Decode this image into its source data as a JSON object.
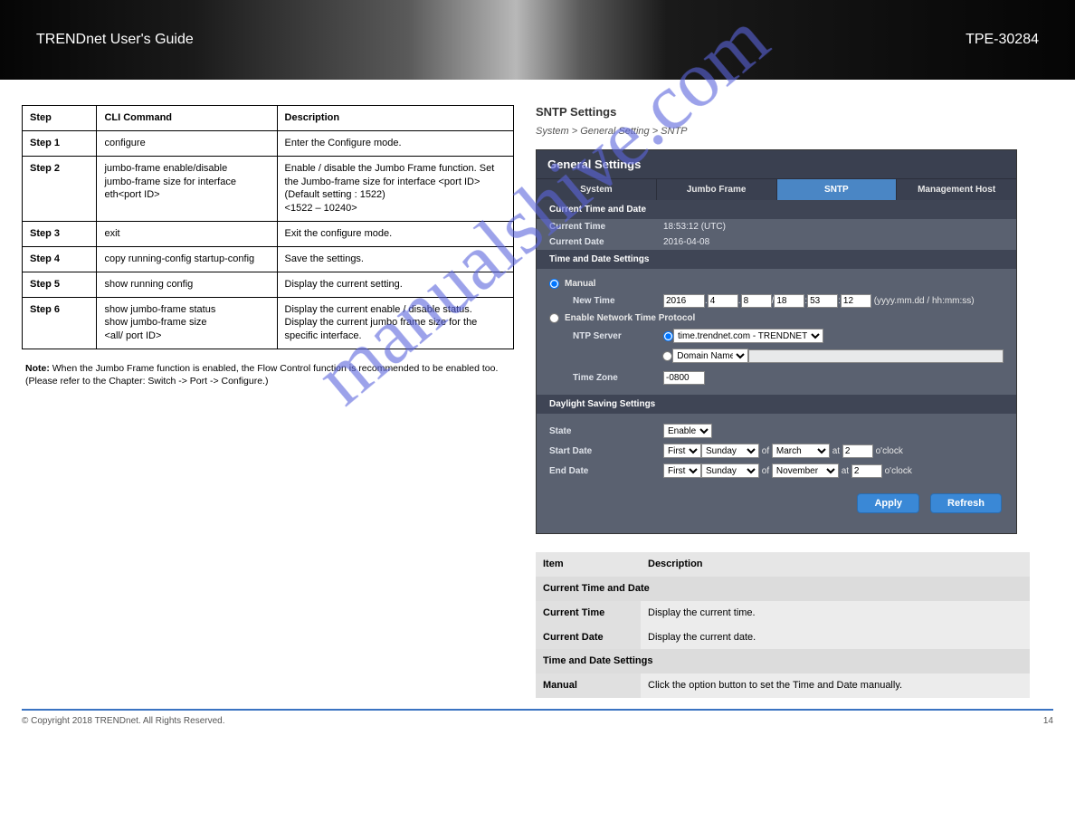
{
  "header": {
    "brand": "TRENDnet User's Guide",
    "model": "TPE-30284"
  },
  "left_table": {
    "head": {
      "c1": "Step",
      "c2": "CLI Command",
      "c3": "Description"
    },
    "rows": [
      {
        "c1": "Step 1",
        "c2": "configure",
        "c3": "Enter the Configure mode."
      },
      {
        "c1": "Step 2",
        "c2": "jumbo-frame enable/disable\njumbo-frame size for interface eth<port ID>",
        "c3": "Enable / disable the Jumbo Frame function. Set the Jumbo-frame size for interface <port ID> (Default setting : 1522)\n<1522 – 10240>"
      },
      {
        "c1": "Step 3",
        "c2": "exit",
        "c3": "Exit the configure mode."
      },
      {
        "c1": "Step 4",
        "c2": "copy running-config startup-config",
        "c3": "Save the settings."
      },
      {
        "c1": "Step 5",
        "c2": "show running config",
        "c3": "Display the current setting."
      },
      {
        "c1": "Step 6",
        "c2": "show jumbo-frame status\nshow jumbo-frame size\n<all/ port ID>",
        "c3": "Display the current enable / disable status.\nDisplay the current jumbo frame size for the specific interface."
      }
    ]
  },
  "left_note_label": "Note:",
  "left_note_text": "When the Jumbo Frame function is enabled, the Flow Control function is recommended to be enabled too. (Please refer to the Chapter: Switch -> Port -> Configure.)",
  "sntp_section": {
    "heading": "SNTP Settings",
    "sub": "System > General Setting > SNTP"
  },
  "panel": {
    "title": "General Settings",
    "tabs": [
      "System",
      "Jumbo Frame",
      "SNTP",
      "Management Host"
    ],
    "active_tab": 2,
    "cur_date_hdr": "Current Time and Date",
    "cur_time_label": "Current Time",
    "cur_time_val": "18:53:12 (UTC)",
    "cur_date_label": "Current Date",
    "cur_date_val": "2016-04-08",
    "td_settings": "Time and Date Settings",
    "manual_label": "Manual",
    "new_time_label": "New Time",
    "new_time": {
      "yyyy": "2016",
      "mm": "4",
      "dd": "8",
      "hh": "18",
      "mi": "53",
      "ss": "12"
    },
    "new_time_hint": "(yyyy.mm.dd / hh:mm:ss)",
    "ntp_label": "Enable Network Time Protocol",
    "ntp_server_label": "NTP Server",
    "ntp_server_select": "time.trendnet.com - TRENDNET",
    "domain_name_label": "Domain Name",
    "tz_label": "Time Zone",
    "tz_val": "-0800",
    "ds_hdr": "Daylight Saving Settings",
    "state_label": "State",
    "state_val": "Enable",
    "start_label": "Start Date",
    "start": {
      "ord": "First",
      "day": "Sunday",
      "of": "of",
      "month": "March",
      "at": "at",
      "hr": "2",
      "oclock": "o'clock"
    },
    "end_label": "End Date",
    "end": {
      "ord": "First",
      "day": "Sunday",
      "of": "of",
      "month": "November",
      "at": "at",
      "hr": "2",
      "oclock": "o'clock"
    },
    "apply": "Apply",
    "refresh": "Refresh"
  },
  "desc": {
    "head": {
      "item": "Item",
      "desc": "Description"
    },
    "grp1": "Current Time and Date",
    "r1": {
      "l": "Current Time",
      "v": "Display the current time."
    },
    "r2": {
      "l": "Current Date",
      "v": "Display the current date."
    },
    "grp2": "Time and Date Settings",
    "r3": {
      "l": "Manual",
      "v": "Click the option button to set the Time and Date manually."
    }
  },
  "footer": {
    "left": "© Copyright 2018 TRENDnet. All Rights Reserved.",
    "right": "14"
  },
  "watermark": "manualshive.com"
}
